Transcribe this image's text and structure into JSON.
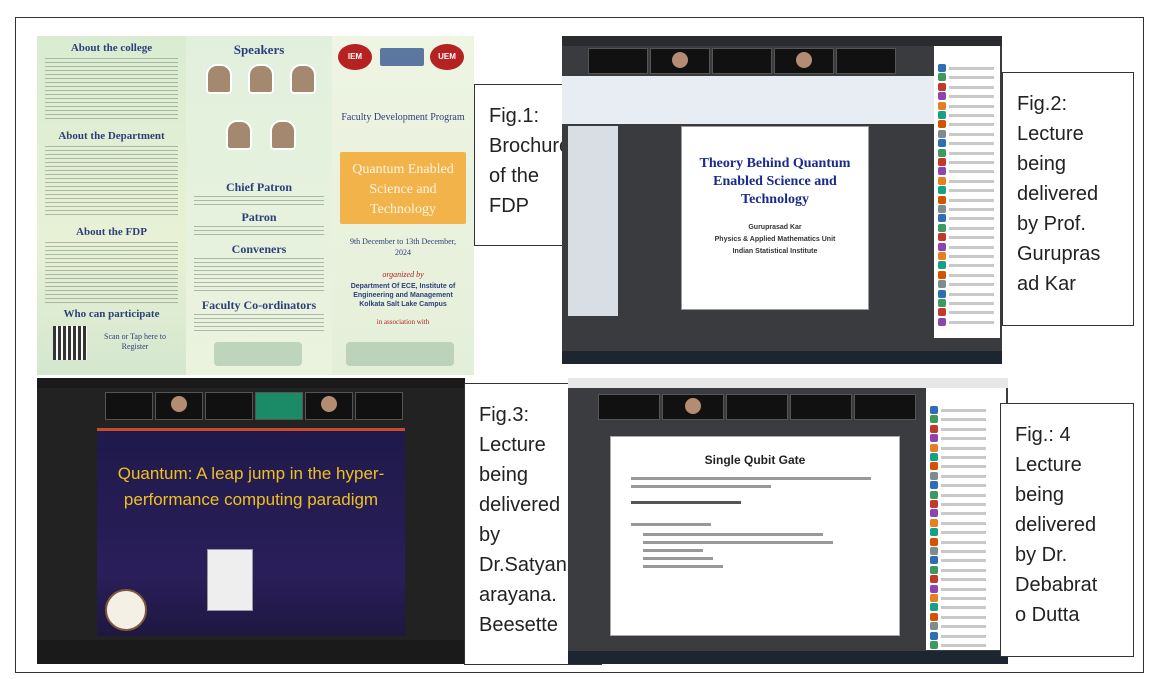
{
  "captions": {
    "fig1": "Fig.1:\nBrochure\nof the\nFDP",
    "fig2": "Fig.2:\nLecture\nbeing\ndelivered\nby Prof.\nGurupras\nad Kar",
    "fig3": "Fig.3:\nLecture\nbeing\ndelivered\nby\nDr.Satyan\narayana.\nBeesette",
    "fig4": "Fig.: 4\nLecture\nbeing\ndelivered\nby Dr.\nDebabrat\no Dutta"
  },
  "brochure": {
    "about_college": "About the college",
    "about_department": "About the Department",
    "about_fdp": "About the FDP",
    "who_can_participate": "Who can participate",
    "register": "Scan or Tap here to Register",
    "speakers": "Speakers",
    "chief_patron": "Chief Patron",
    "patron": "Patron",
    "conveners": "Conveners",
    "faculty_coordinators": "Faculty Co-ordinators",
    "logos": [
      "IEM",
      "UEM"
    ],
    "program_type": "Faculty Development Program",
    "program_title": "Quantum Enabled Science and Technology",
    "dates": "9th December to 13th December, 2024",
    "organized_by": "organized by",
    "department": "Department Of ECE, Institute of Engineering and Management Kolkata Salt Lake Campus",
    "in_association": "in association with"
  },
  "lecture2": {
    "slide_title": "Theory Behind Quantum Enabled Science and Technology",
    "speaker": "Guruprasad Kar",
    "unit": "Physics & Applied Mathematics Unit",
    "institute": "Indian Statistical Institute"
  },
  "lecture3": {
    "slide_title": "Quantum: A leap jump in the hyper-performance computing paradigm"
  },
  "lecture4": {
    "slide_title": "Single Qubit Gate"
  }
}
